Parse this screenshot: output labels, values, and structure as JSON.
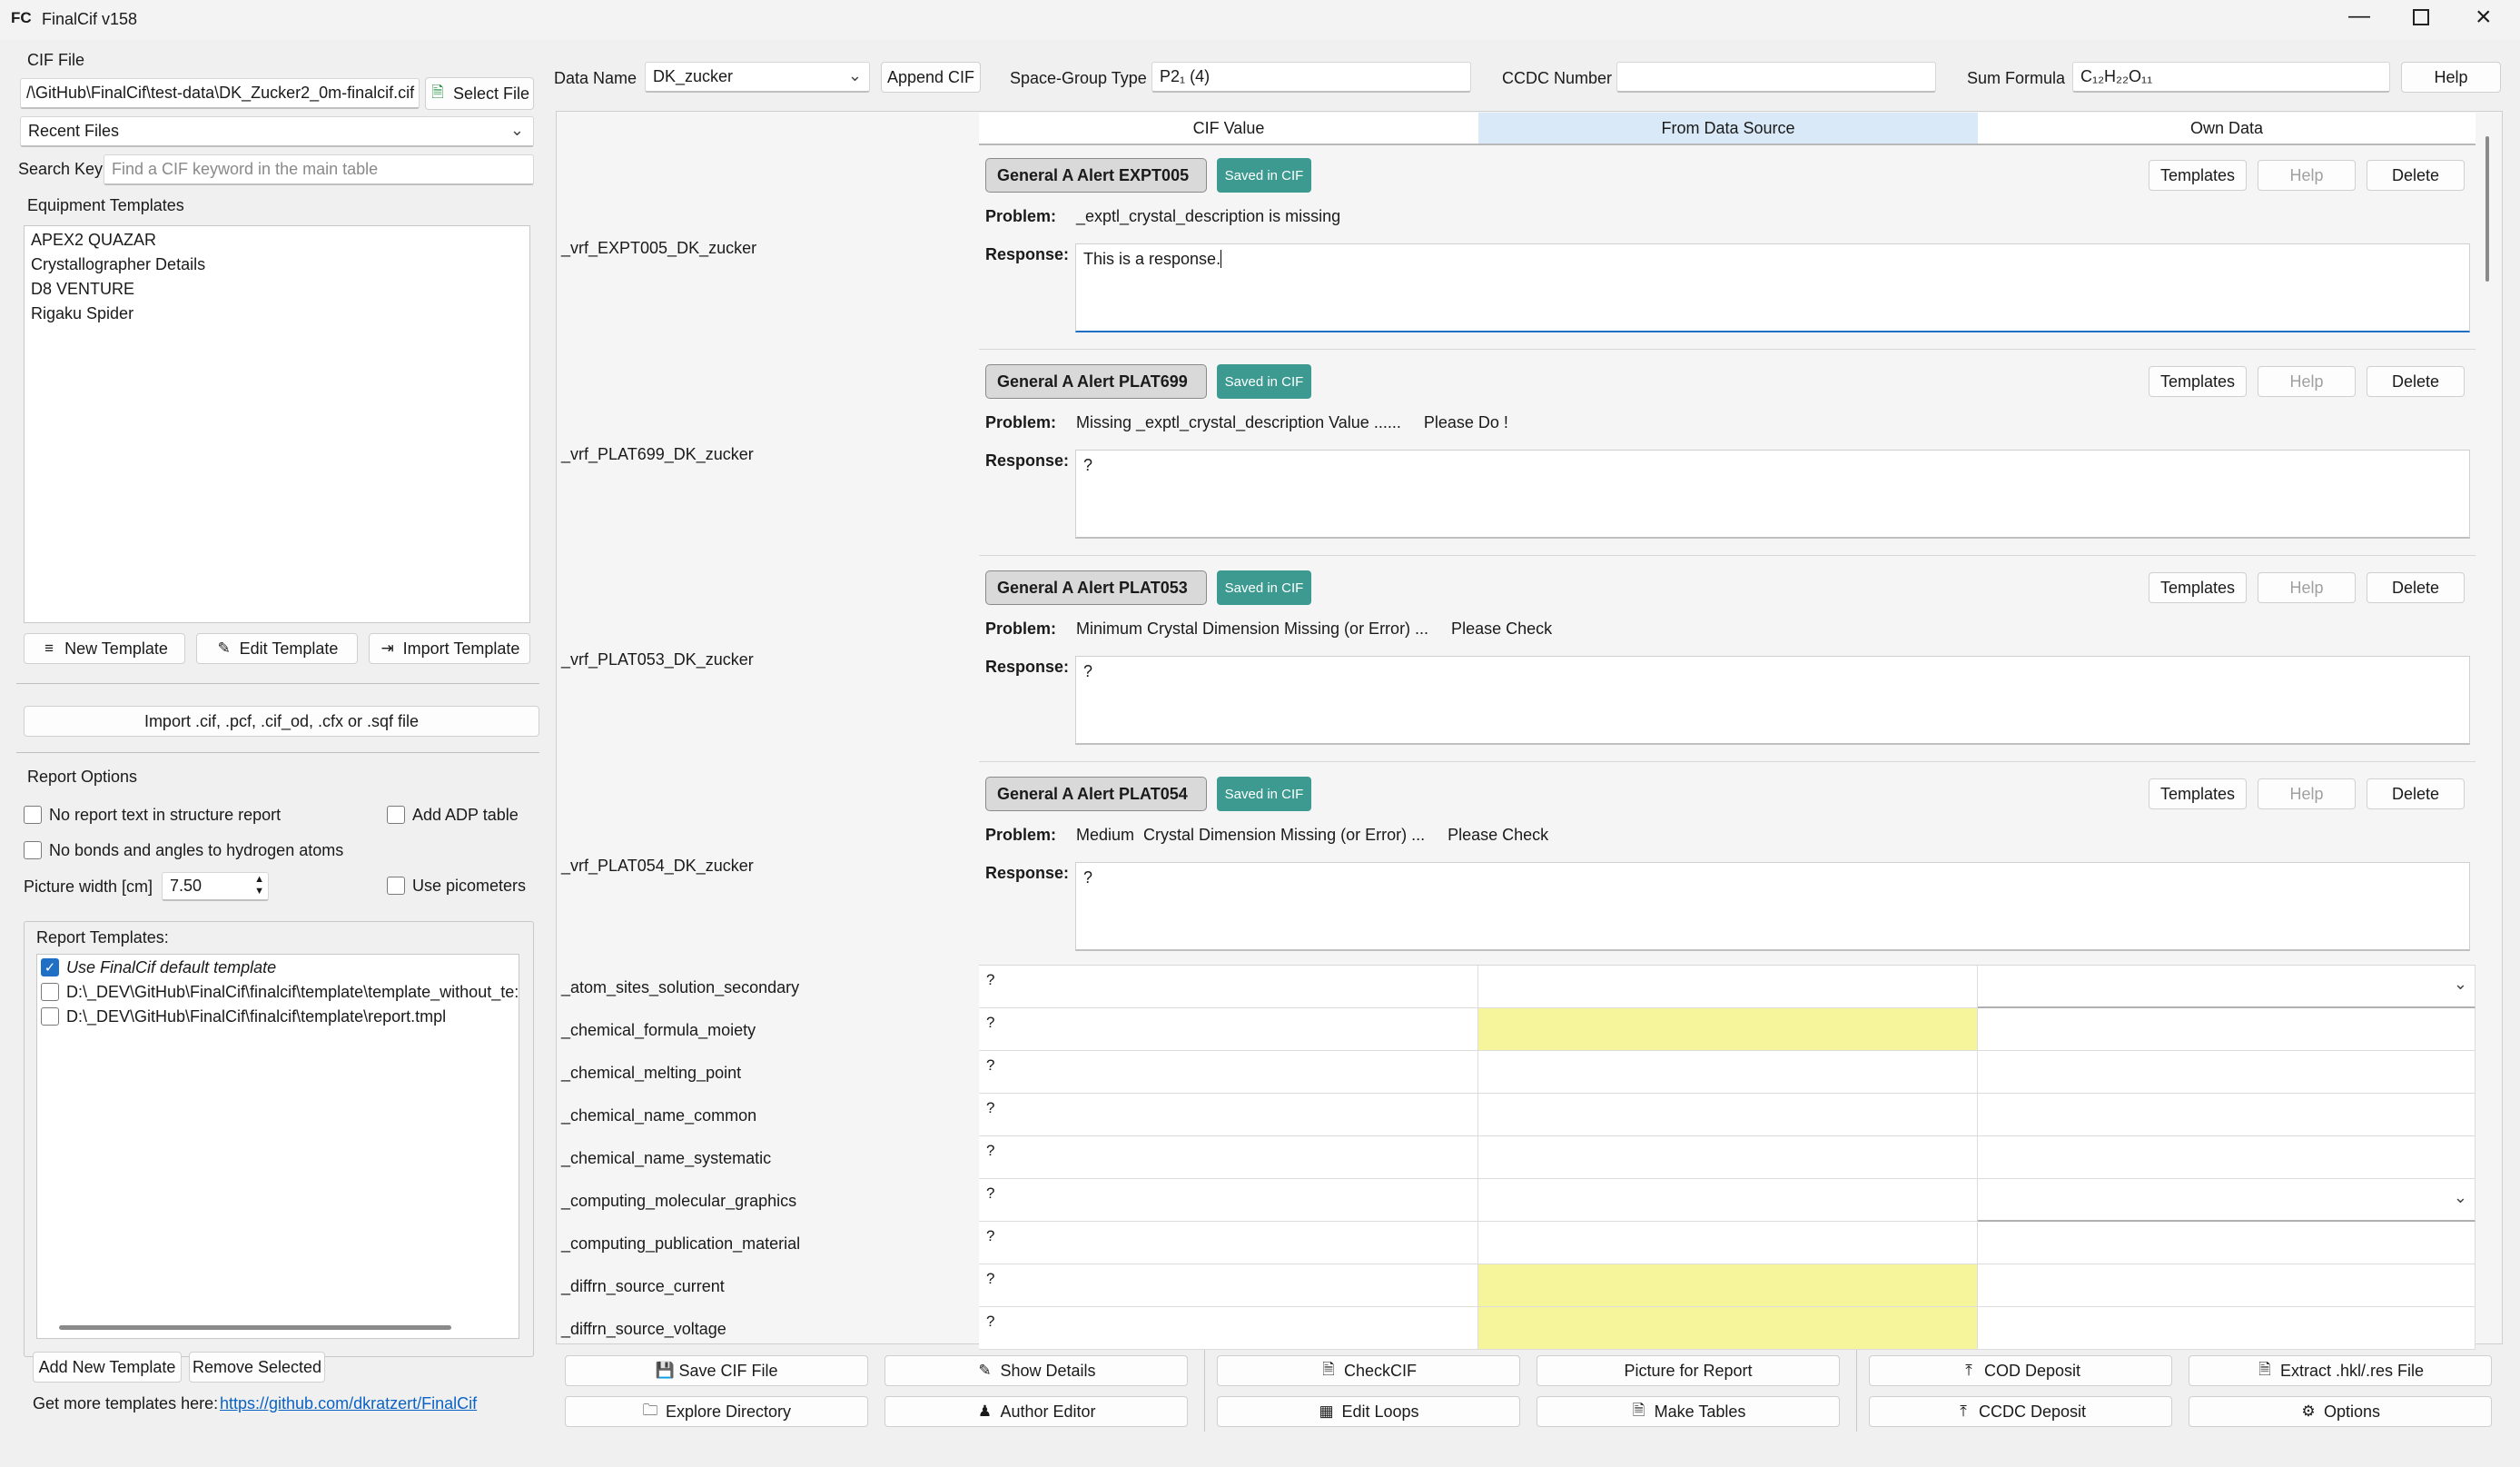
{
  "window": {
    "app_icon": "FC",
    "title": "FinalCif v158",
    "minimize_icon": "minimize-icon",
    "maximize_icon": "maximize-icon",
    "close_icon": "close-icon"
  },
  "left": {
    "cif_file_label": "CIF File",
    "cif_file_path": "/\\GitHub\\FinalCif\\test-data\\DK_Zucker2_0m-finalcif.cif",
    "select_file_label": "Select File",
    "recent_files_label": "Recent Files",
    "search_key_label": "Search Key",
    "search_key_placeholder": "Find a CIF keyword in the main table",
    "equipment_templates_label": "Equipment Templates",
    "equipment_templates": [
      "APEX2 QUAZAR",
      "Crystallographer Details",
      "D8 VENTURE",
      "Rigaku Spider"
    ],
    "new_template_label": "New Template",
    "edit_template_label": "Edit Template",
    "import_template_label": "Import Template",
    "import_file_label": "Import .cif, .pcf, .cif_od, .cfx or .sqf file",
    "report_options_label": "Report Options",
    "no_report_text_label": "No report text in structure report",
    "add_adp_label": "Add ADP table",
    "no_bonds_label": "No bonds and angles to hydrogen atoms",
    "picture_width_label": "Picture width [cm]",
    "picture_width_value": "7.50",
    "use_picometers_label": "Use picometers",
    "report_templates_label": "Report Templates:",
    "report_templates": [
      {
        "label": "Use FinalCif default template",
        "checked": true
      },
      {
        "label": "D:\\_DEV\\GitHub\\FinalCif\\finalcif\\template\\template_without_te:",
        "checked": false
      },
      {
        "label": "D:\\_DEV\\GitHub\\FinalCif\\finalcif\\template\\report.tmpl",
        "checked": false
      }
    ],
    "add_new_template_label": "Add New Template",
    "remove_selected_label": "Remove Selected",
    "more_templates_text": "Get more templates here:",
    "more_templates_link": "https://github.com/dkratzert/FinalCif"
  },
  "top": {
    "data_name_label": "Data Name",
    "data_name_value": "DK_zucker",
    "append_cif_label": "Append CIF",
    "space_group_label": "Space-Group Type",
    "space_group_value": "P2₁ (4)",
    "ccdc_label": "CCDC Number",
    "ccdc_value": "",
    "sum_formula_label": "Sum Formula",
    "sum_formula_value": "C₁₂H₂₂O₁₁",
    "help_label": "Help"
  },
  "table": {
    "col_cif_value": "CIF Value",
    "col_data_source": "From Data Source",
    "col_own_data": "Own Data",
    "alerts": [
      {
        "key": "_vrf_EXPT005_DK_zucker",
        "header": "General A  Alert EXPT005",
        "badge": "Saved in CIF",
        "problem_label": "Problem:",
        "problem": "_exptl_crystal_description is missing",
        "response_label": "Response:",
        "response": "This is a response.",
        "templates": "Templates",
        "help": "Help",
        "delete": "Delete"
      },
      {
        "key": "_vrf_PLAT699_DK_zucker",
        "header": "General A  Alert PLAT699",
        "badge": "Saved in CIF",
        "problem_label": "Problem:",
        "problem": "Missing _exptl_crystal_description Value ......     Please Do !",
        "response_label": "Response:",
        "response": "?",
        "templates": "Templates",
        "help": "Help",
        "delete": "Delete"
      },
      {
        "key": "_vrf_PLAT053_DK_zucker",
        "header": "General A  Alert PLAT053",
        "badge": "Saved in CIF",
        "problem_label": "Problem:",
        "problem": "Minimum Crystal Dimension Missing (or Error) ...     Please Check",
        "response_label": "Response:",
        "response": "?",
        "templates": "Templates",
        "help": "Help",
        "delete": "Delete"
      },
      {
        "key": "_vrf_PLAT054_DK_zucker",
        "header": "General A  Alert PLAT054",
        "badge": "Saved in CIF",
        "problem_label": "Problem:",
        "problem": "Medium  Crystal Dimension Missing (or Error) ...     Please Check",
        "response_label": "Response:",
        "response": "?",
        "templates": "Templates",
        "help": "Help",
        "delete": "Delete"
      }
    ],
    "rows": [
      {
        "key": "_atom_sites_solution_secondary",
        "cif": "?",
        "yellow": false,
        "dropdown": true
      },
      {
        "key": "_chemical_formula_moiety",
        "cif": "?",
        "yellow": true,
        "dropdown": false
      },
      {
        "key": "_chemical_melting_point",
        "cif": "?",
        "yellow": false,
        "dropdown": false
      },
      {
        "key": "_chemical_name_common",
        "cif": "?",
        "yellow": false,
        "dropdown": false
      },
      {
        "key": "_chemical_name_systematic",
        "cif": "?",
        "yellow": false,
        "dropdown": false
      },
      {
        "key": "_computing_molecular_graphics",
        "cif": "?",
        "yellow": false,
        "dropdown": true
      },
      {
        "key": "_computing_publication_material",
        "cif": "?",
        "yellow": false,
        "dropdown": false
      },
      {
        "key": "_diffrn_source_current",
        "cif": "?",
        "yellow": true,
        "dropdown": false
      },
      {
        "key": "_diffrn_source_voltage",
        "cif": "?",
        "yellow": true,
        "dropdown": false
      }
    ]
  },
  "bottom": {
    "save_cif": "Save CIF File",
    "show_details": "Show Details",
    "checkcif": "CheckCIF",
    "picture_report": "Picture for Report",
    "cod_deposit": "COD Deposit",
    "extract_hkl": "Extract .hkl/.res File",
    "explore_dir": "Explore Directory",
    "author_editor": "Author Editor",
    "edit_loops": "Edit Loops",
    "make_tables": "Make Tables",
    "ccdc_deposit": "CCDC Deposit",
    "options": "Options"
  },
  "colors": {
    "accent": "#1f6fc5",
    "saved_badge": "#3c9a91",
    "highlight_yellow": "#f7f59b",
    "data_source_header": "#d9e9f7"
  }
}
